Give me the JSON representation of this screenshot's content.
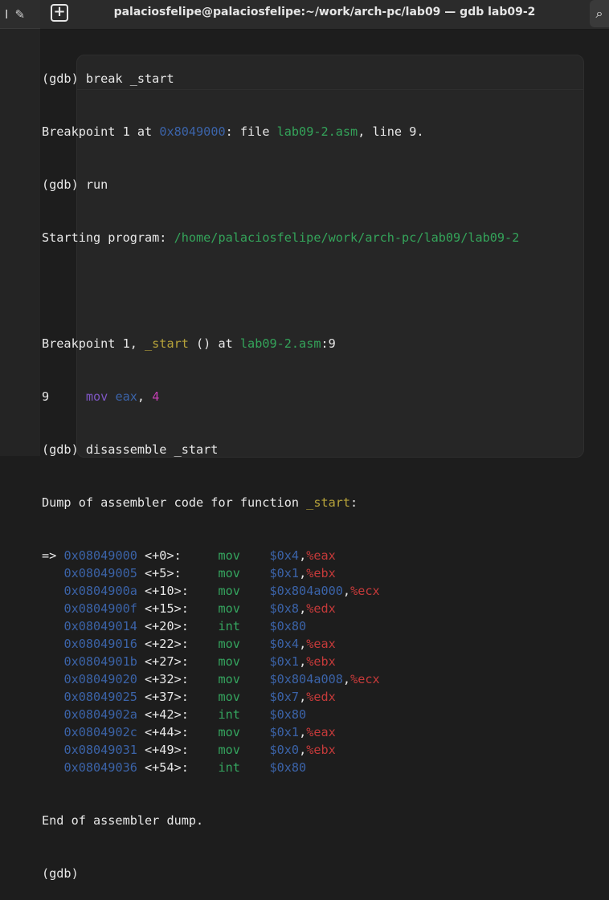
{
  "window": {
    "title": "palaciosfelipe@palaciosfelipe:~/work/arch-pc/lab09 — gdb lab09-2",
    "new_tab_icon": "plus-box-icon",
    "search_icon": "search-icon"
  },
  "left_window": {
    "icons": [
      "text-cursor-icon",
      "pencil-icon"
    ]
  },
  "terminal": {
    "cmd_break": "(gdb) break _start",
    "bp_prefix": "Breakpoint 1 at ",
    "bp_addr": "0x8049000",
    "bp_mid": ": file ",
    "bp_file": "lab09-2.asm",
    "bp_suffix": ", line 9.",
    "cmd_run": "(gdb) run",
    "start_prefix": "Starting program: ",
    "start_path": "/home/palaciosfelipe/work/arch-pc/lab09/lab09-2",
    "hit_prefix": "Breakpoint 1, ",
    "hit_func": "_start",
    "hit_mid": " () at ",
    "hit_file": "lab09-2.asm",
    "hit_line": ":9",
    "src_lineno": "9",
    "src_mnem": "mov",
    "src_reg": "eax",
    "src_sep": ", ",
    "src_num": "4",
    "cmd_disasm": "(gdb) disassemble _start",
    "dump_prefix": "Dump of assembler code for function ",
    "dump_func": "_start",
    "dump_suffix": ":",
    "disasm": [
      {
        "marker": "=> ",
        "addr": "0x08049000",
        "off": " <+0>:     ",
        "inst": "mov",
        "op1": "$0x4",
        "comma": ",",
        "op2": "%eax"
      },
      {
        "marker": "   ",
        "addr": "0x08049005",
        "off": " <+5>:     ",
        "inst": "mov",
        "op1": "$0x1",
        "comma": ",",
        "op2": "%ebx"
      },
      {
        "marker": "   ",
        "addr": "0x0804900a",
        "off": " <+10>:    ",
        "inst": "mov",
        "op1": "$0x804a000",
        "comma": ",",
        "op2": "%ecx"
      },
      {
        "marker": "   ",
        "addr": "0x0804900f",
        "off": " <+15>:    ",
        "inst": "mov",
        "op1": "$0x8",
        "comma": ",",
        "op2": "%edx"
      },
      {
        "marker": "   ",
        "addr": "0x08049014",
        "off": " <+20>:    ",
        "inst": "int",
        "op1": "$0x80",
        "comma": "",
        "op2": ""
      },
      {
        "marker": "   ",
        "addr": "0x08049016",
        "off": " <+22>:    ",
        "inst": "mov",
        "op1": "$0x4",
        "comma": ",",
        "op2": "%eax"
      },
      {
        "marker": "   ",
        "addr": "0x0804901b",
        "off": " <+27>:    ",
        "inst": "mov",
        "op1": "$0x1",
        "comma": ",",
        "op2": "%ebx"
      },
      {
        "marker": "   ",
        "addr": "0x08049020",
        "off": " <+32>:    ",
        "inst": "mov",
        "op1": "$0x804a008",
        "comma": ",",
        "op2": "%ecx"
      },
      {
        "marker": "   ",
        "addr": "0x08049025",
        "off": " <+37>:    ",
        "inst": "mov",
        "op1": "$0x7",
        "comma": ",",
        "op2": "%edx"
      },
      {
        "marker": "   ",
        "addr": "0x0804902a",
        "off": " <+42>:    ",
        "inst": "int",
        "op1": "$0x80",
        "comma": "",
        "op2": ""
      },
      {
        "marker": "   ",
        "addr": "0x0804902c",
        "off": " <+44>:    ",
        "inst": "mov",
        "op1": "$0x1",
        "comma": ",",
        "op2": "%eax"
      },
      {
        "marker": "   ",
        "addr": "0x08049031",
        "off": " <+49>:    ",
        "inst": "mov",
        "op1": "$0x0",
        "comma": ",",
        "op2": "%ebx"
      },
      {
        "marker": "   ",
        "addr": "0x08049036",
        "off": " <+54>:    ",
        "inst": "int",
        "op1": "$0x80",
        "comma": "",
        "op2": ""
      }
    ],
    "end_dump": "End of assembler dump.",
    "prompt": "(gdb) "
  },
  "colors": {
    "background": "#1d1d1d",
    "foreground": "#e8e8e8",
    "address": "#3b63a8",
    "file": "#34a45a",
    "function": "#b7a33a",
    "register": "#c53a3a"
  }
}
